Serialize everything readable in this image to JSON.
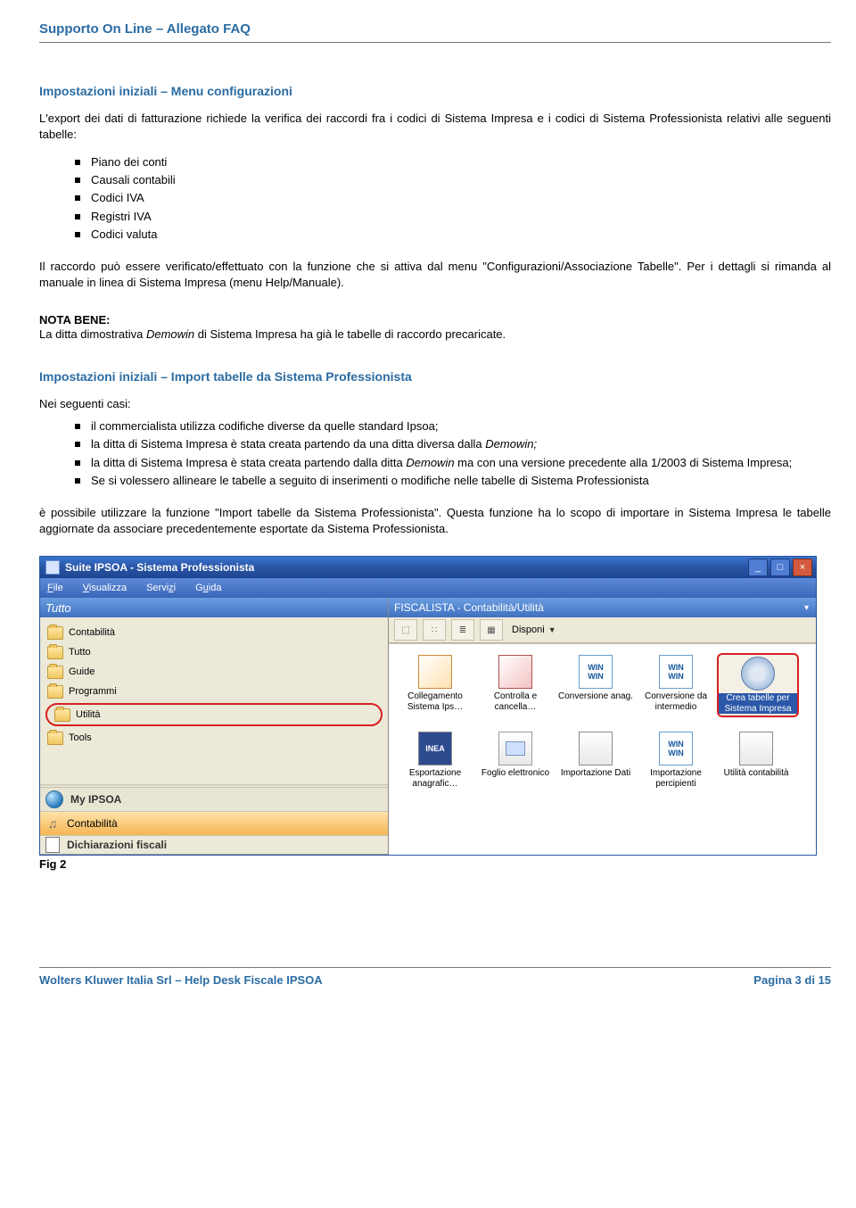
{
  "doc": {
    "header": "Supporto On Line – Allegato FAQ",
    "section1_title": "Impostazioni iniziali – Menu configurazioni",
    "intro_para": "L'export dei dati di fatturazione richiede la verifica dei raccordi fra i codici di Sistema Impresa e i codici di Sistema Professionista relativi alle seguenti tabelle:",
    "list1": [
      "Piano dei conti",
      "Causali contabili",
      "Codici IVA",
      "Registri IVA",
      "Codici valuta"
    ],
    "raccordo_para": "Il raccordo può essere verificato/effettuato con la funzione che si attiva dal menu \"Configurazioni/Associazione Tabelle\". Per i dettagli si rimanda al manuale in linea di Sistema Impresa (menu Help/Manuale).",
    "nota_bene_label": "NOTA BENE:",
    "nota_bene_text_a": "La ditta dimostrativa ",
    "nota_bene_demowin": "Demowin",
    "nota_bene_text_b": " di Sistema Impresa ha già le tabelle di raccordo precaricate.",
    "section2_title": "Impostazioni iniziali – Import tabelle da Sistema Professionista",
    "nei_seguenti": "Nei seguenti casi:",
    "list2": [
      {
        "pre": "il commercialista utilizza codifiche diverse da quelle standard Ipsoa;",
        "em": "",
        "post": ""
      },
      {
        "pre": "la ditta di Sistema Impresa è stata creata partendo da una ditta diversa dalla ",
        "em": "Demowin;",
        "post": ""
      },
      {
        "pre": "la ditta di Sistema Impresa è stata creata partendo dalla ditta ",
        "em": "Demowin",
        "post": " ma con una versione precedente alla 1/2003 di Sistema Impresa;"
      },
      {
        "pre": "Se si volessero allineare le tabelle a seguito di inserimenti o modifiche nelle tabelle di Sistema Professionista",
        "em": "",
        "post": ""
      }
    ],
    "closing_para": "è possibile utilizzare la funzione \"Import tabelle da Sistema Professionista\". Questa funzione ha lo scopo di importare in Sistema Impresa le tabelle aggiornate da associare precedentemente esportate da Sistema Professionista.",
    "fig_caption": "Fig 2",
    "footer_left": "Wolters Kluwer Italia Srl – Help Desk Fiscale IPSOA",
    "footer_right": "Pagina 3 di 15"
  },
  "app": {
    "title": "Suite IPSOA - Sistema Professionista",
    "menu": {
      "file": "File",
      "visualizza": "Visualizza",
      "servizi": "Servizi",
      "guida": "Guida"
    },
    "left": {
      "header": "Tutto",
      "items": [
        "Contabilità",
        "Tutto",
        "Guide",
        "Programmi",
        "Utilità",
        "Tools"
      ],
      "bottom": {
        "my_ipsoa": "My IPSOA",
        "contabilita": "Contabilità",
        "dich": "Dichiarazioni fiscali"
      }
    },
    "right": {
      "header": "FISCALISTA - Contabilità/Utilità",
      "disponi": "Disponi",
      "items": [
        {
          "label": "Collegamento Sistema Ips…",
          "ic": "people"
        },
        {
          "label": "Controlla e cancella…",
          "ic": "redx"
        },
        {
          "label": "Conversione anag.",
          "ic": "winwin"
        },
        {
          "label": "Conversione da intermedio",
          "ic": "winwin"
        },
        {
          "label": "Crea tabelle per Sistema Impresa",
          "ic": "disc",
          "highlight": true
        },
        {
          "label": "Esportazione anagrafic…",
          "ic": "inea"
        },
        {
          "label": "Foglio elettronico",
          "ic": "doc"
        },
        {
          "label": "Importazione Dati",
          "ic": "stack"
        },
        {
          "label": "Importazione percipienti",
          "ic": "winwin"
        },
        {
          "label": "Utilità contabilità",
          "ic": "stack"
        }
      ]
    }
  }
}
